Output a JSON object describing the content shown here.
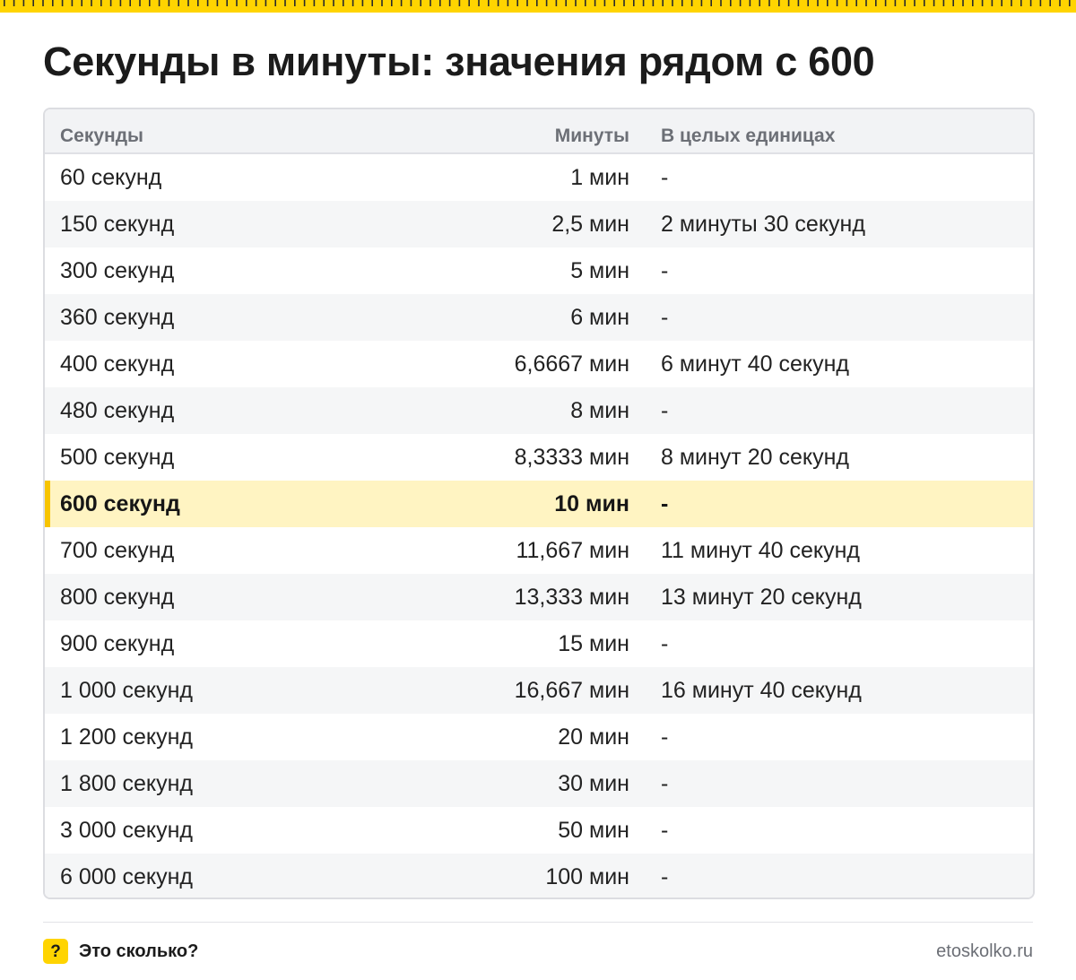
{
  "colors": {
    "accent": "#ffd400",
    "highlight_row": "#fff4c2",
    "highlight_bar": "#f7c400",
    "header_bg": "#f2f3f5",
    "alt_row": "#f5f6f7",
    "muted_text": "#6c6f76"
  },
  "page": {
    "title": "Секунды в минуты: значения рядом с 600"
  },
  "table": {
    "headers": [
      "Секунды",
      "Минуты",
      "В целых единицах"
    ],
    "highlighted_row_index": 7,
    "rows": [
      [
        "60 секунд",
        "1 мин",
        "-"
      ],
      [
        "150 секунд",
        "2,5 мин",
        "2 минуты 30 секунд"
      ],
      [
        "300 секунд",
        "5 мин",
        "-"
      ],
      [
        "360 секунд",
        "6 мин",
        "-"
      ],
      [
        "400 секунд",
        "6,6667 мин",
        "6 минут 40 секунд"
      ],
      [
        "480 секунд",
        "8 мин",
        "-"
      ],
      [
        "500 секунд",
        "8,3333 мин",
        "8 минут 20 секунд"
      ],
      [
        "600 секунд",
        "10 мин",
        "-"
      ],
      [
        "700 секунд",
        "11,667 мин",
        "11 минут 40 секунд"
      ],
      [
        "800 секунд",
        "13,333 мин",
        "13 минут 20 секунд"
      ],
      [
        "900 секунд",
        "15 мин",
        "-"
      ],
      [
        "1 000 секунд",
        "16,667 мин",
        "16 минут 40 секунд"
      ],
      [
        "1 200 секунд",
        "20 мин",
        "-"
      ],
      [
        "1 800 секунд",
        "30 мин",
        "-"
      ],
      [
        "3 000 секунд",
        "50 мин",
        "-"
      ],
      [
        "6 000 секунд",
        "100 мин",
        "-"
      ]
    ]
  },
  "footer": {
    "logo_icon": "question-mark-icon",
    "logo_glyph": "?",
    "brand": "Это сколько?",
    "site": "etoskolko.ru"
  }
}
